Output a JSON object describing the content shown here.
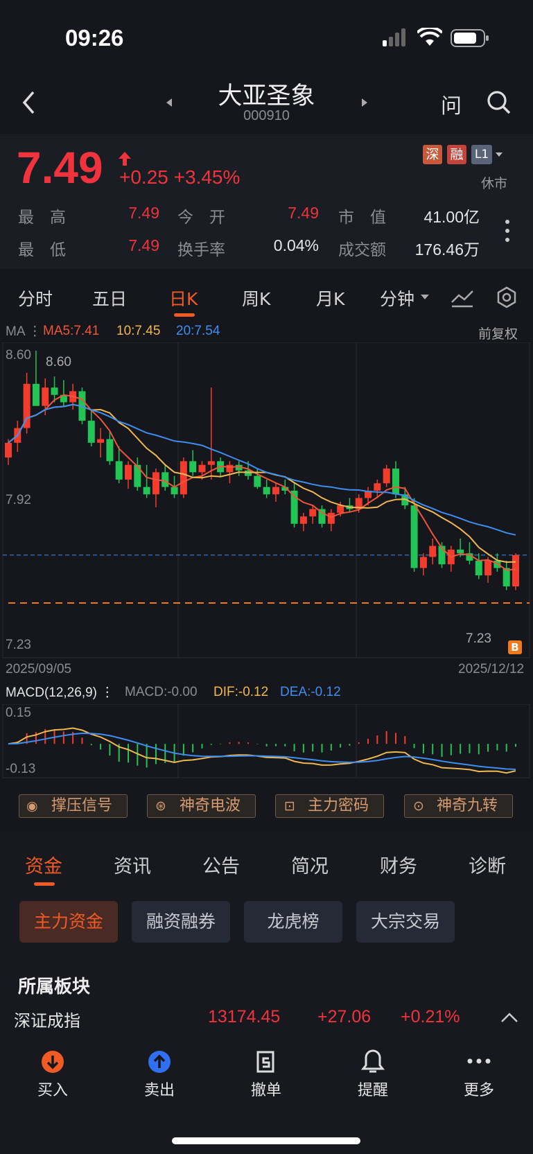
{
  "status_bar": {
    "time": "09:26"
  },
  "header": {
    "title": "大亚圣象",
    "code": "000910",
    "ask_label": "问"
  },
  "quote": {
    "price": "7.49",
    "change": "+0.25",
    "change_pct": "+3.45%",
    "badges": [
      "深",
      "融",
      "L1"
    ],
    "market_state": "休市",
    "rows": [
      [
        {
          "label": "最　高",
          "value": "7.49"
        },
        {
          "label": "今　开",
          "value": "7.49"
        },
        {
          "label": "市　值",
          "value": "41.00亿"
        }
      ],
      [
        {
          "label": "最　低",
          "value": "7.49"
        },
        {
          "label": "换手率",
          "value": "0.04%"
        },
        {
          "label": "成交额",
          "value": "176.46万"
        }
      ]
    ]
  },
  "chart_tabs": [
    "分时",
    "五日",
    "日K",
    "周K",
    "月K",
    "分钟"
  ],
  "active_tab": "日K",
  "chart_data": [
    {
      "type": "candlestick",
      "title": "",
      "ma_label": "MA",
      "ma": {
        "ma5": "MA5:7.41",
        "ma10": "10:7.45",
        "ma20": "20:7.54"
      },
      "adjust_label": "前复权",
      "y_ticks": [
        "8.60",
        "7.92",
        "7.23"
      ],
      "ylim": [
        7.23,
        8.6
      ],
      "high_marker": "8.60",
      "low_marker": "7.23",
      "x_start": "2025/09/05",
      "x_end": "2025/12/12",
      "buy_marker": "B",
      "colors": {
        "up": "#f23d2e",
        "down": "#22c455",
        "ma5": "#f0553a",
        "ma10": "#f0b850",
        "ma20": "#3d8ef0"
      },
      "candles": [
        [
          8.02,
          8.12,
          7.98,
          8.1
        ],
        [
          8.1,
          8.22,
          8.05,
          8.18
        ],
        [
          8.18,
          8.48,
          8.15,
          8.42
        ],
        [
          8.42,
          8.6,
          8.38,
          8.3
        ],
        [
          8.3,
          8.45,
          8.25,
          8.4
        ],
        [
          8.4,
          8.46,
          8.32,
          8.36
        ],
        [
          8.36,
          8.44,
          8.3,
          8.32
        ],
        [
          8.32,
          8.42,
          8.28,
          8.38
        ],
        [
          8.38,
          8.4,
          8.2,
          8.22
        ],
        [
          8.22,
          8.28,
          8.08,
          8.1
        ],
        [
          8.1,
          8.18,
          8.02,
          8.12
        ],
        [
          8.12,
          8.16,
          7.98,
          8.0
        ],
        [
          8.0,
          8.08,
          7.88,
          7.9
        ],
        [
          7.9,
          8.0,
          7.85,
          7.98
        ],
        [
          7.98,
          8.02,
          7.84,
          7.86
        ],
        [
          7.86,
          7.98,
          7.8,
          7.82
        ],
        [
          7.82,
          7.96,
          7.75,
          7.94
        ],
        [
          7.94,
          7.98,
          7.84,
          7.86
        ],
        [
          7.86,
          7.92,
          7.8,
          7.82
        ],
        [
          7.82,
          8.02,
          7.8,
          8.0
        ],
        [
          8.0,
          8.06,
          7.92,
          7.94
        ],
        [
          7.94,
          8.0,
          7.9,
          7.98
        ],
        [
          7.98,
          8.4,
          7.9,
          8.0
        ],
        [
          8.0,
          8.02,
          7.92,
          7.94
        ],
        [
          7.94,
          8.0,
          7.88,
          7.98
        ],
        [
          7.98,
          8.0,
          7.92,
          7.95
        ],
        [
          7.95,
          8.0,
          7.9,
          7.92
        ],
        [
          7.92,
          7.96,
          7.85,
          7.86
        ],
        [
          7.86,
          7.9,
          7.8,
          7.82
        ],
        [
          7.82,
          7.88,
          7.78,
          7.86
        ],
        [
          7.86,
          7.9,
          7.82,
          7.84
        ],
        [
          7.84,
          7.88,
          7.64,
          7.66
        ],
        [
          7.66,
          7.72,
          7.62,
          7.7
        ],
        [
          7.7,
          7.76,
          7.66,
          7.74
        ],
        [
          7.74,
          7.76,
          7.64,
          7.66
        ],
        [
          7.66,
          7.74,
          7.62,
          7.72
        ],
        [
          7.72,
          7.78,
          7.7,
          7.76
        ],
        [
          7.76,
          7.8,
          7.72,
          7.74
        ],
        [
          7.74,
          7.82,
          7.72,
          7.8
        ],
        [
          7.8,
          7.86,
          7.76,
          7.84
        ],
        [
          7.84,
          7.9,
          7.8,
          7.88
        ],
        [
          7.88,
          7.98,
          7.86,
          7.96
        ],
        [
          7.96,
          8.0,
          7.8,
          7.82
        ],
        [
          7.82,
          7.86,
          7.74,
          7.76
        ],
        [
          7.76,
          7.8,
          7.4,
          7.42
        ],
        [
          7.42,
          7.5,
          7.38,
          7.48
        ],
        [
          7.48,
          7.58,
          7.44,
          7.54
        ],
        [
          7.54,
          7.56,
          7.42,
          7.44
        ],
        [
          7.44,
          7.54,
          7.4,
          7.52
        ],
        [
          7.52,
          7.58,
          7.48,
          7.5
        ],
        [
          7.5,
          7.56,
          7.44,
          7.46
        ],
        [
          7.46,
          7.5,
          7.36,
          7.38
        ],
        [
          7.38,
          7.48,
          7.34,
          7.46
        ],
        [
          7.46,
          7.5,
          7.4,
          7.42
        ],
        [
          7.42,
          7.46,
          7.3,
          7.32
        ],
        [
          7.32,
          7.5,
          7.3,
          7.49
        ]
      ]
    },
    {
      "type": "macd",
      "label": "MACD(12,26,9)",
      "macd": "MACD:-0.00",
      "dif": "DIF:-0.12",
      "dea": "DEA:-0.12",
      "y_ticks": [
        "0.15",
        "-0.13"
      ],
      "ylim": [
        -0.13,
        0.15
      ]
    }
  ],
  "signals": [
    "撑压信号",
    "神奇电波",
    "主力密码",
    "神奇九转"
  ],
  "info_tabs": [
    "资金",
    "资讯",
    "公告",
    "简况",
    "财务",
    "诊断"
  ],
  "pills": [
    "主力资金",
    "融资融券",
    "龙虎榜",
    "大宗交易"
  ],
  "sector": {
    "title": "所属板块",
    "name": "深证成指",
    "value": "13174.45",
    "change": "+27.06",
    "pct": "+0.21%"
  },
  "actions": [
    "买入",
    "卖出",
    "撤单",
    "提醒",
    "更多"
  ],
  "accent": "#f05a24"
}
